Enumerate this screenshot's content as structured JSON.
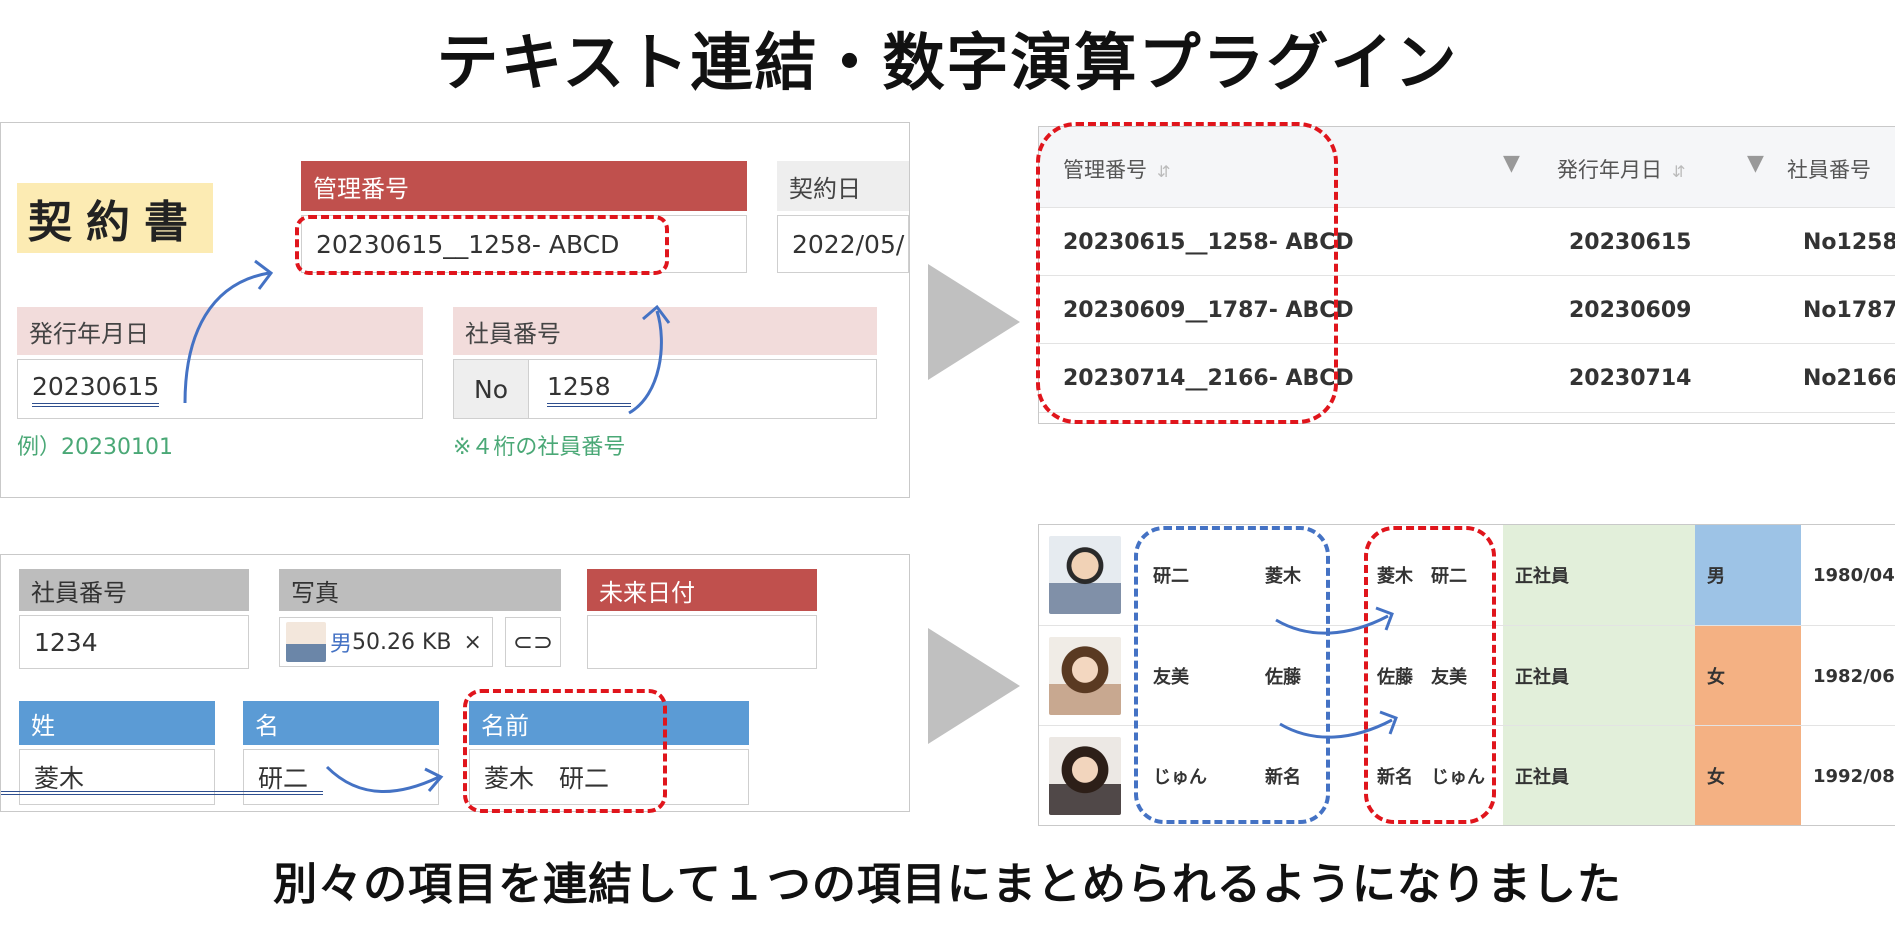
{
  "title": "テキスト連結・数字演算プラグイン",
  "subtitle": "別々の項目を連結して１つの項目にまとめられるようになりました",
  "form1": {
    "stamp": "契約書",
    "mgmt_label": "管理番号",
    "mgmt_value": "20230615__1258- ABCD",
    "contract_label": "契約日",
    "contract_value": "2022/05/",
    "issue_label": "発行年月日",
    "issue_value": "20230615",
    "issue_hint": "例）20230101",
    "emp_label": "社員番号",
    "emp_prefix": "No",
    "emp_value": "1258",
    "emp_hint": "※４桁の社員番号"
  },
  "table1": {
    "headers": [
      "管理番号",
      "発行年月日",
      "社員番号"
    ],
    "rows": [
      {
        "mgmt": "20230615__1258- ABCD",
        "date": "20230615",
        "emp": "No1258"
      },
      {
        "mgmt": "20230609__1787- ABCD",
        "date": "20230609",
        "emp": "No1787"
      },
      {
        "mgmt": "20230714__2166- ABCD",
        "date": "20230714",
        "emp": "No2166"
      }
    ]
  },
  "form2": {
    "emp_label": "社員番号",
    "emp_value": "1234",
    "photo_label": "写真",
    "photo_file": "男",
    "photo_size": "50.26 KB",
    "photo_remove": "×",
    "future_label": "未来日付",
    "last_label": "姓",
    "last_value": "菱木",
    "first_label": "名",
    "first_value": "研二",
    "full_label": "名前",
    "full_value": "菱木　研二"
  },
  "table2": {
    "rows": [
      {
        "first": "研二",
        "last": "菱木",
        "full": "菱木　研二",
        "type": "正社員",
        "gender": "男",
        "gender_color": "#9dc3e6",
        "birth": "1980/04"
      },
      {
        "first": "友美",
        "last": "佐藤",
        "full": "佐藤　友美",
        "type": "正社員",
        "gender": "女",
        "gender_color": "#f4b183",
        "birth": "1982/06"
      },
      {
        "first": "じゅん",
        "last": "新名",
        "full": "新名　じゅん",
        "type": "正社員",
        "gender": "女",
        "gender_color": "#f4b183",
        "birth": "1992/08"
      }
    ]
  },
  "colors": {
    "accent_red": "#c0504d",
    "accent_blue": "#5b9bd5",
    "dash_red": "#e0151c",
    "dash_blue": "#4472c4",
    "arrow": "#4472c4"
  }
}
